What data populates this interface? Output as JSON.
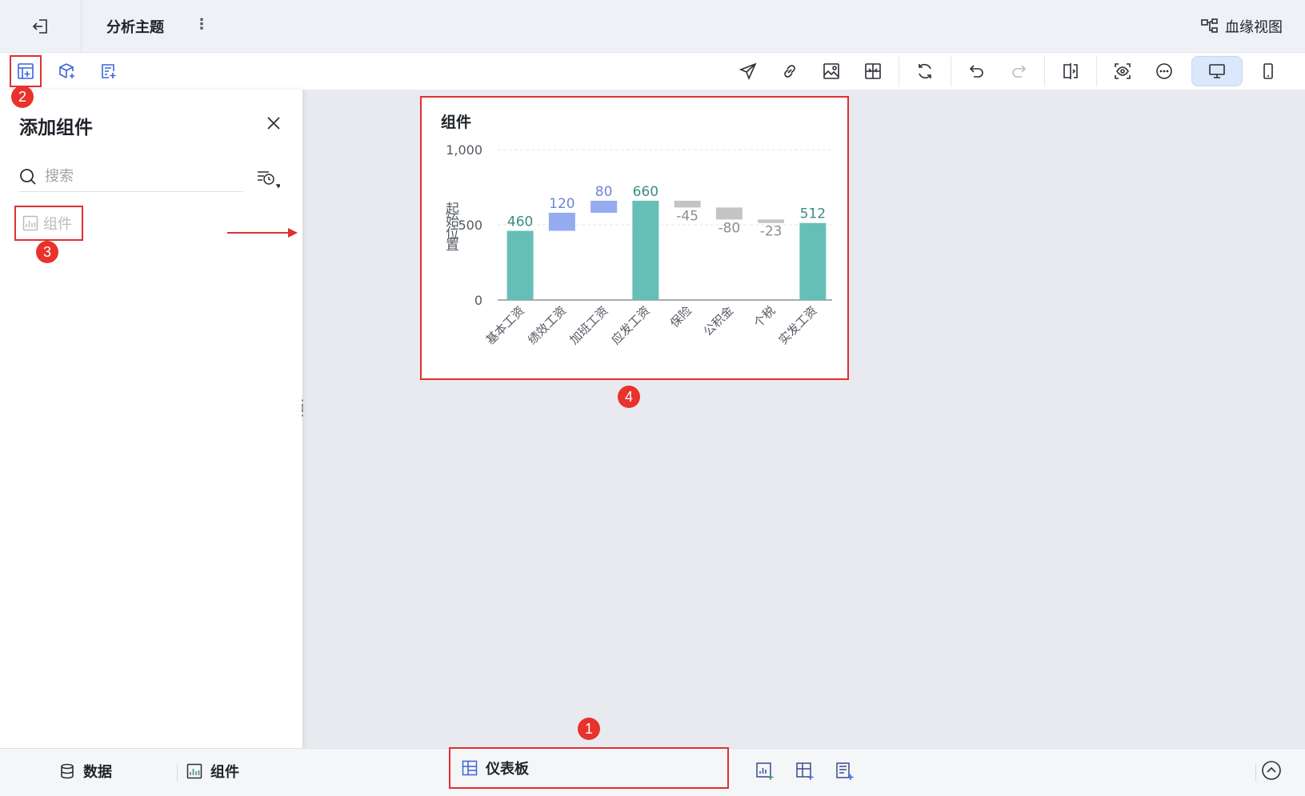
{
  "titlebar": {
    "title": "分析主题",
    "more_label": "⋮",
    "lineage_label": "血缘视图"
  },
  "panel": {
    "title": "添加组件",
    "search_placeholder": "搜索",
    "component_item_label": "组件"
  },
  "badges": [
    "1",
    "2",
    "3",
    "4"
  ],
  "card": {
    "title": "组件"
  },
  "bottombar": {
    "data_label": "数据",
    "component_label": "组件",
    "dashboard_label": "仪表板"
  },
  "colors": {
    "total": "#66bfb6",
    "increase": "#94abf0",
    "decrease": "#c4c4c4",
    "highlight": "#e03030"
  },
  "chart_data": {
    "type": "bar",
    "subtype": "waterfall",
    "ylabel": "起始位置",
    "ylim": [
      0,
      1000
    ],
    "yticks": [
      "0",
      "500",
      "1,000"
    ],
    "categories": [
      "基本工资",
      "绩效工资",
      "加班工资",
      "应发工资",
      "保险",
      "公积金",
      "个税",
      "实发工资"
    ],
    "bars": [
      {
        "category": "基本工资",
        "kind": "total",
        "start": 0,
        "end": 460,
        "label": "460"
      },
      {
        "category": "绩效工资",
        "kind": "increase",
        "start": 460,
        "end": 580,
        "label": "120"
      },
      {
        "category": "加班工资",
        "kind": "increase",
        "start": 580,
        "end": 660,
        "label": "80"
      },
      {
        "category": "应发工资",
        "kind": "total",
        "start": 0,
        "end": 660,
        "label": "660"
      },
      {
        "category": "保险",
        "kind": "decrease",
        "start": 660,
        "end": 615,
        "label": "-45"
      },
      {
        "category": "公积金",
        "kind": "decrease",
        "start": 615,
        "end": 535,
        "label": "-80"
      },
      {
        "category": "个税",
        "kind": "decrease",
        "start": 535,
        "end": 512,
        "label": "-23"
      },
      {
        "category": "实发工资",
        "kind": "total",
        "start": 0,
        "end": 512,
        "label": "512"
      }
    ],
    "grid": true
  }
}
